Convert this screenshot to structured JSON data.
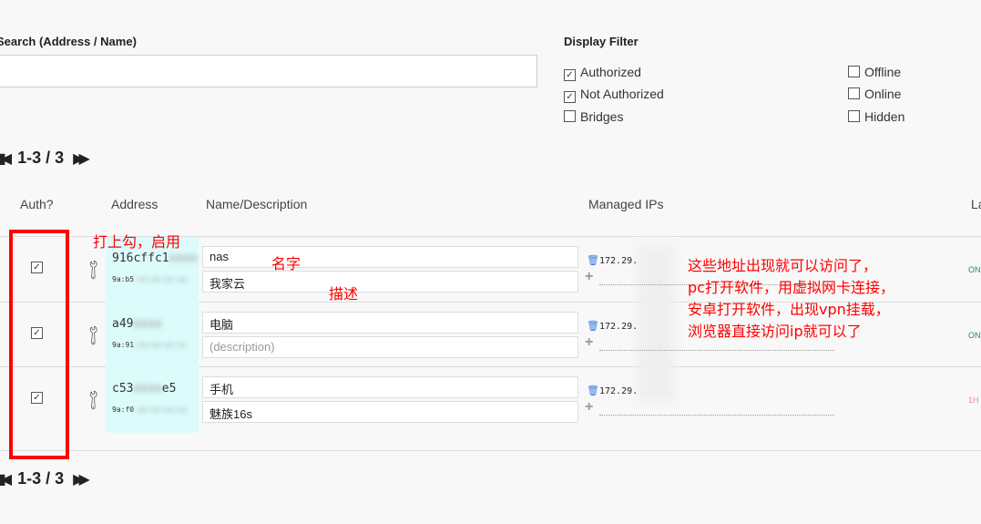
{
  "search": {
    "label": "Search (Address / Name)",
    "value": ""
  },
  "filter": {
    "title": "Display Filter",
    "options": [
      {
        "label": "Authorized",
        "checked": true
      },
      {
        "label": "Not Authorized",
        "checked": true
      },
      {
        "label": "Bridges",
        "checked": false
      },
      {
        "label": "Offline",
        "checked": false
      },
      {
        "label": "Online",
        "checked": false
      },
      {
        "label": "Hidden",
        "checked": false
      }
    ]
  },
  "pager": {
    "range": "1-3 / 3"
  },
  "columns": [
    "Auth?",
    "Address",
    "Name/Description",
    "Managed IPs",
    "La"
  ],
  "rows": [
    {
      "authorized": true,
      "address_visible": "916cffc1",
      "address_sub": "9a:b5",
      "name": "nas",
      "description": "我家云",
      "description_placeholder": "(description)",
      "ip": "172.29.",
      "status": "ON",
      "status_color": "#1a8a7a"
    },
    {
      "authorized": true,
      "address_visible": "a49",
      "address_sub": "9a:91",
      "name": "电脑",
      "description": "",
      "description_placeholder": "(description)",
      "ip": "172.29.",
      "status": "ON",
      "status_color": "#1a8a7a"
    },
    {
      "authorized": true,
      "address_visible": "c53",
      "address_visible_end": "e5",
      "address_sub": "9a:f0",
      "name": "手机",
      "description": "魅族16s",
      "description_placeholder": "(description)",
      "ip": "172.29.",
      "status": "1H",
      "status_color": "#f080b0"
    }
  ],
  "annotations": {
    "auth": "打上勾，启用",
    "name": "名字",
    "desc": "描述",
    "lines": [
      "这些地址出现就可以访问了，",
      "pc打开软件，用虚拟网卡连接，",
      "安卓打开软件，出现vpn挂载，",
      "浏览器直接访问ip就可以了"
    ]
  }
}
